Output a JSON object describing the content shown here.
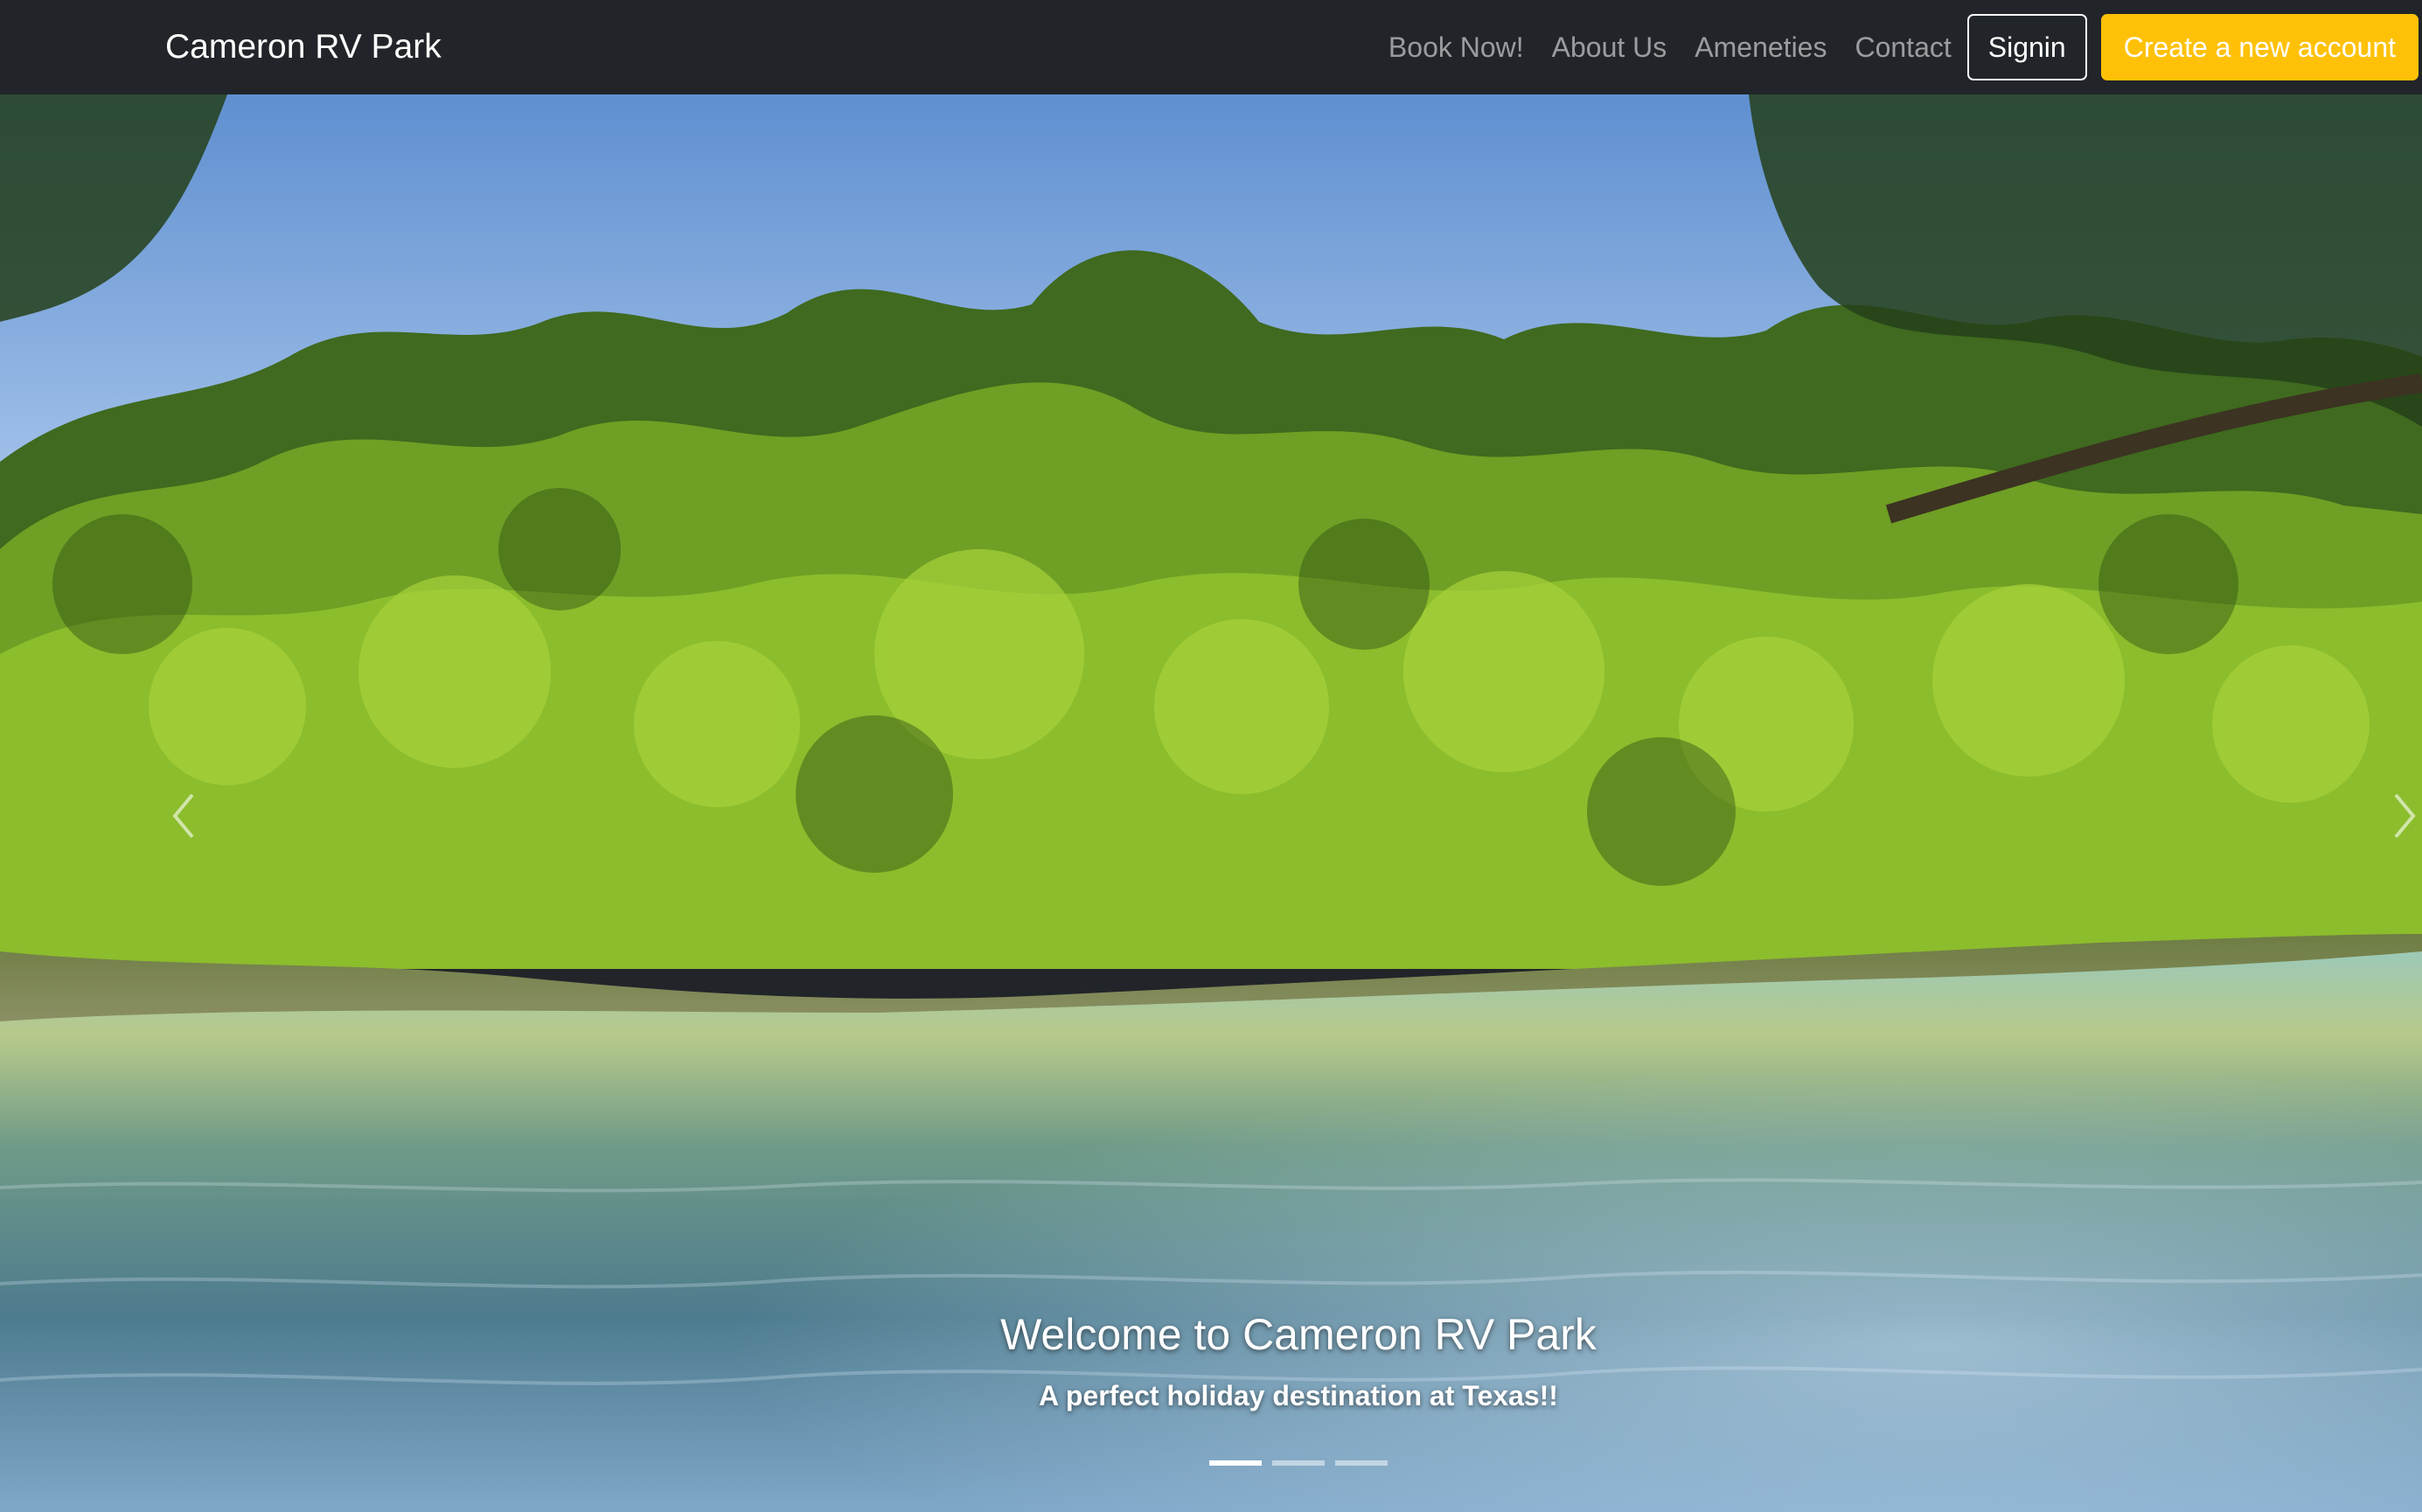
{
  "navbar": {
    "brand": "Cameron RV Park",
    "links": [
      "Book Now!",
      "About Us",
      "Ameneties",
      "Contact"
    ],
    "signin_label": "Signin",
    "create_account_label": "Create a new account"
  },
  "hero": {
    "title": "Welcome to Cameron RV Park",
    "subtitle": "A perfect holiday destination at Texas!!",
    "slide_count": 3,
    "active_slide": 1
  },
  "colors": {
    "navbar_bg": "#212529",
    "accent": "#ffc107"
  },
  "icons": {
    "prev": "chevron-left-icon",
    "next": "chevron-right-icon"
  }
}
